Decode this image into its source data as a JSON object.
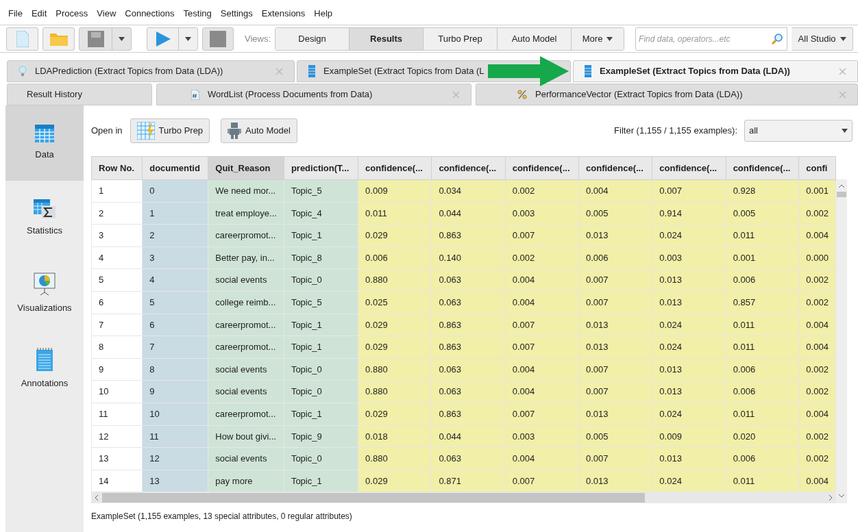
{
  "menu": [
    "File",
    "Edit",
    "Process",
    "View",
    "Connections",
    "Testing",
    "Settings",
    "Extensions",
    "Help"
  ],
  "toolbar": {
    "views_label": "Views:",
    "views": [
      {
        "label": "Design",
        "selected": false
      },
      {
        "label": "Results",
        "selected": true
      },
      {
        "label": "Turbo Prep",
        "selected": false
      },
      {
        "label": "Auto Model",
        "selected": false
      }
    ],
    "more": "More",
    "search": {
      "placeholder": "Find data, operators...etc"
    },
    "scope": "All Studio"
  },
  "tab_rows": [
    [
      {
        "label": "LDAPrediction (Extract Topics from Data (LDA))",
        "kind": "bulb",
        "selected": false,
        "closable": true
      },
      {
        "label": "ExampleSet (Extract Topics from Data (L",
        "kind": "table",
        "selected": false
      },
      {
        "label": "ExampleSet (Extract Topics from Data (LDA))",
        "kind": "table",
        "selected": true,
        "closable": true
      }
    ],
    [
      {
        "label": "Result History",
        "kind": "none",
        "selected": false,
        "closable": false
      },
      {
        "label": "WordList (Process Documents from Data)",
        "kind": "doc",
        "selected": false,
        "closable": true
      },
      {
        "label": "PerformanceVector (Extract Topics from Data (LDA))",
        "kind": "percent",
        "selected": false,
        "closable": true
      }
    ]
  ],
  "sidebar": {
    "items": [
      {
        "label": "Data",
        "kind": "data",
        "selected": true
      },
      {
        "label": "Statistics",
        "kind": "statistics",
        "selected": false
      },
      {
        "label": "Visualizations",
        "kind": "visualizations",
        "selected": false
      },
      {
        "label": "Annotations",
        "kind": "annotations",
        "selected": false
      }
    ]
  },
  "open_in": {
    "label": "Open in",
    "buttons": [
      {
        "label": "Turbo Prep",
        "kind": "turbo"
      },
      {
        "label": "Auto Model",
        "kind": "robot"
      }
    ]
  },
  "filter": {
    "label": "Filter (1,155 / 1,155 examples):",
    "value": "all"
  },
  "table": {
    "columns": [
      {
        "label": "Row No.",
        "kind": "row",
        "selected": false
      },
      {
        "label": "documentid",
        "kind": "id",
        "selected": false
      },
      {
        "label": "Quit_Reason",
        "kind": "special",
        "selected": true
      },
      {
        "label": "prediction(T...",
        "kind": "special",
        "selected": false
      },
      {
        "label": "confidence(...",
        "kind": "confidence",
        "selected": false
      },
      {
        "label": "confidence(...",
        "kind": "confidence",
        "selected": false
      },
      {
        "label": "confidence(...",
        "kind": "confidence",
        "selected": false
      },
      {
        "label": "confidence(...",
        "kind": "confidence",
        "selected": false
      },
      {
        "label": "confidence(...",
        "kind": "confidence",
        "selected": false
      },
      {
        "label": "confidence(...",
        "kind": "confidence",
        "selected": false
      },
      {
        "label": "confi",
        "kind": "confidence",
        "selected": false
      }
    ],
    "rows": [
      [
        "1",
        "0",
        "We need mor...",
        "Topic_5",
        "0.009",
        "0.034",
        "0.002",
        "0.004",
        "0.007",
        "0.928",
        "0.001"
      ],
      [
        "2",
        "1",
        "treat employe...",
        "Topic_4",
        "0.011",
        "0.044",
        "0.003",
        "0.005",
        "0.914",
        "0.005",
        "0.002"
      ],
      [
        "3",
        "2",
        "careerpromot...",
        "Topic_1",
        "0.029",
        "0.863",
        "0.007",
        "0.013",
        "0.024",
        "0.011",
        "0.004"
      ],
      [
        "4",
        "3",
        "Better pay, in...",
        "Topic_8",
        "0.006",
        "0.140",
        "0.002",
        "0.006",
        "0.003",
        "0.001",
        "0.000"
      ],
      [
        "5",
        "4",
        "social events",
        "Topic_0",
        "0.880",
        "0.063",
        "0.004",
        "0.007",
        "0.013",
        "0.006",
        "0.002"
      ],
      [
        "6",
        "5",
        "college reimb...",
        "Topic_5",
        "0.025",
        "0.063",
        "0.004",
        "0.007",
        "0.013",
        "0.857",
        "0.002"
      ],
      [
        "7",
        "6",
        "careerpromot...",
        "Topic_1",
        "0.029",
        "0.863",
        "0.007",
        "0.013",
        "0.024",
        "0.011",
        "0.004"
      ],
      [
        "8",
        "7",
        "careerpromot...",
        "Topic_1",
        "0.029",
        "0.863",
        "0.007",
        "0.013",
        "0.024",
        "0.011",
        "0.004"
      ],
      [
        "9",
        "8",
        "social events",
        "Topic_0",
        "0.880",
        "0.063",
        "0.004",
        "0.007",
        "0.013",
        "0.006",
        "0.002"
      ],
      [
        "10",
        "9",
        "social events",
        "Topic_0",
        "0.880",
        "0.063",
        "0.004",
        "0.007",
        "0.013",
        "0.006",
        "0.002"
      ],
      [
        "11",
        "10",
        "careerpromot...",
        "Topic_1",
        "0.029",
        "0.863",
        "0.007",
        "0.013",
        "0.024",
        "0.011",
        "0.004"
      ],
      [
        "12",
        "11",
        "How bout givi...",
        "Topic_9",
        "0.018",
        "0.044",
        "0.003",
        "0.005",
        "0.009",
        "0.020",
        "0.002"
      ],
      [
        "13",
        "12",
        "social events",
        "Topic_0",
        "0.880",
        "0.063",
        "0.004",
        "0.007",
        "0.013",
        "0.006",
        "0.002"
      ],
      [
        "14",
        "13",
        "pay more",
        "Topic_1",
        "0.029",
        "0.871",
        "0.007",
        "0.013",
        "0.024",
        "0.011",
        "0.004"
      ]
    ]
  },
  "status": "ExampleSet (1,155 examples, 13 special attributes, 0 regular attributes)"
}
